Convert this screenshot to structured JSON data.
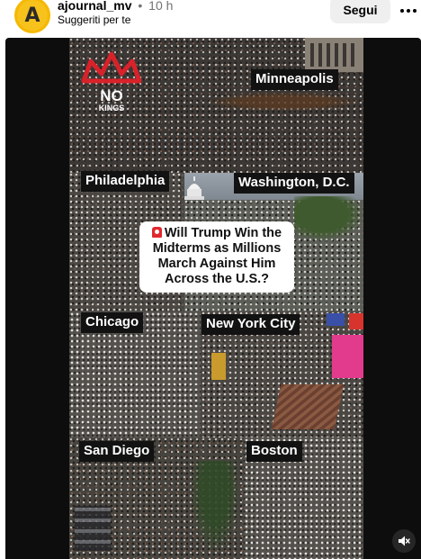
{
  "post_header": {
    "avatar_letter": "A",
    "username": "ajournal_mv",
    "separator": "•",
    "time_ago": "10 h",
    "subtitle": "Suggeriti per te",
    "follow_label": "Segui"
  },
  "video": {
    "logo_text": "NO KINGS",
    "city_labels": {
      "minneapolis": "Minneapolis",
      "philadelphia": "Philadelphia",
      "washington": "Washington, D.C.",
      "chicago": "Chicago",
      "new_york": "New York City",
      "san_diego": "San Diego",
      "boston": "Boston"
    },
    "headline": "Will Trump Win the Midterms as Millions March Against Him Across the U.S.?",
    "headline_icon": "siren-icon"
  },
  "controls": {
    "mute_icon": "speaker-muted-icon"
  },
  "colors": {
    "follow_bg": "#efefef",
    "avatar": "#f5b800",
    "label_bg": "#121212",
    "logo_red": "#d8222a"
  }
}
